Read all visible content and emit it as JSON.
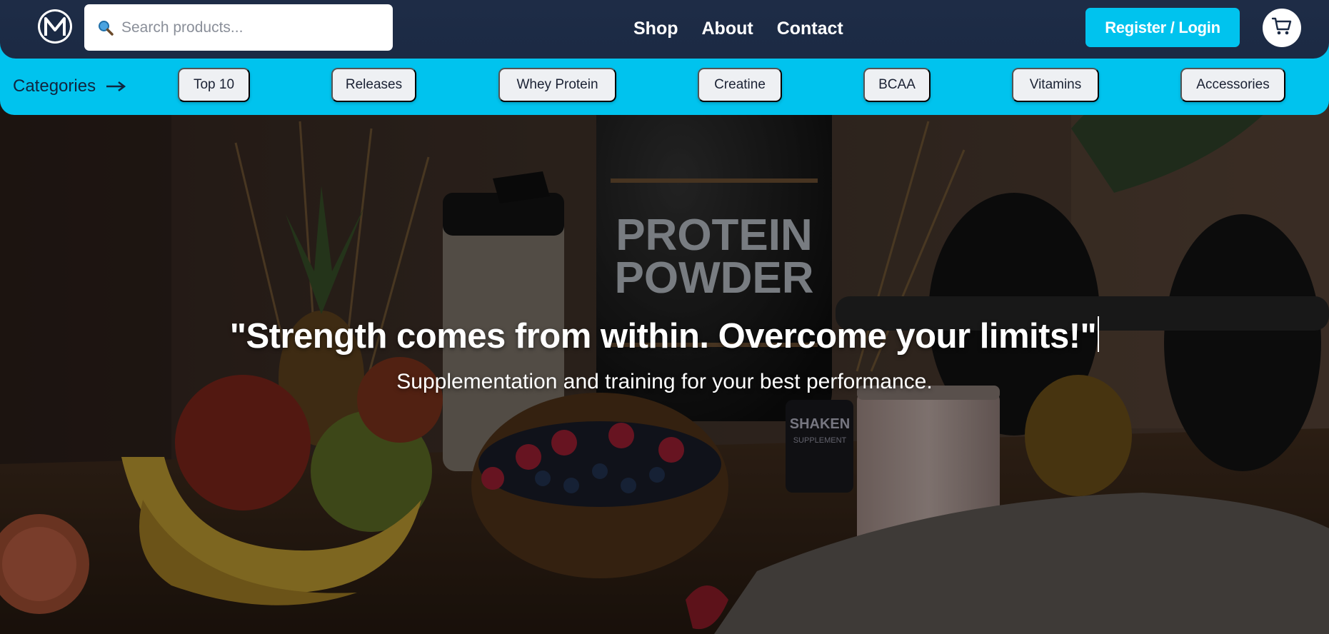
{
  "header": {
    "logo_icon": "m-logo-icon",
    "search": {
      "placeholder": "Search products...",
      "icon": "magnifier-icon"
    },
    "nav": [
      {
        "label": "Shop"
      },
      {
        "label": "About"
      },
      {
        "label": "Contact"
      }
    ],
    "register_label": "Register / Login",
    "cart_icon": "cart-icon"
  },
  "categories": {
    "label": "Categories",
    "arrow_icon": "arrow-right-icon",
    "items": [
      {
        "label": "Top 10"
      },
      {
        "label": "Releases"
      },
      {
        "label": "Whey Protein"
      },
      {
        "label": "Creatine"
      },
      {
        "label": "BCAA"
      },
      {
        "label": "Vitamins"
      },
      {
        "label": "Accessories"
      }
    ]
  },
  "hero": {
    "quote": "\"Strength comes from within. Overcome your limits!\"",
    "subtitle": "Supplementation and training for your best performance.",
    "image": {
      "tub_text_1": "PROTEIN",
      "tub_text_2": "POWDER",
      "jar_text_1": "SHAKEN",
      "jar_text_2": "SUPPLEMENT"
    }
  },
  "colors": {
    "header_bg": "#1b2a44",
    "accent": "#00c3ee",
    "pill_bg": "#eef0f3",
    "text_white": "#ffffff"
  }
}
